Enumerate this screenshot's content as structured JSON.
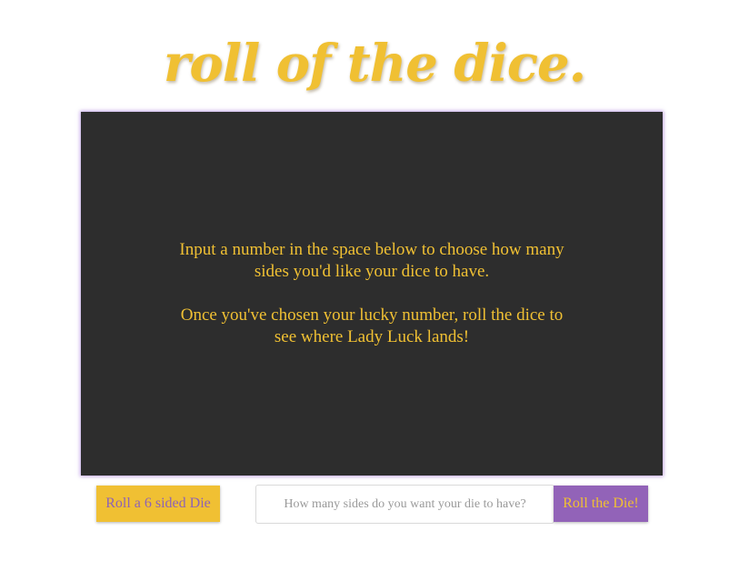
{
  "header": {
    "title": "roll of the dice."
  },
  "stage": {
    "instruction_line_1": "Input a number in the space below to choose how many sides you'd like your dice to have.",
    "instruction_line_2": "Once you've chosen your lucky number, roll the dice to see where Lady Luck lands!"
  },
  "controls": {
    "roll_six_label": "Roll a 6 sided Die",
    "sides_input_value": "",
    "sides_input_placeholder": "How many sides do you want your die to have?",
    "roll_button_label": "Roll the Die!"
  },
  "colors": {
    "accent_gold": "#f0c033",
    "accent_purple": "#9263b8",
    "stage_background": "#2d2d2d"
  }
}
